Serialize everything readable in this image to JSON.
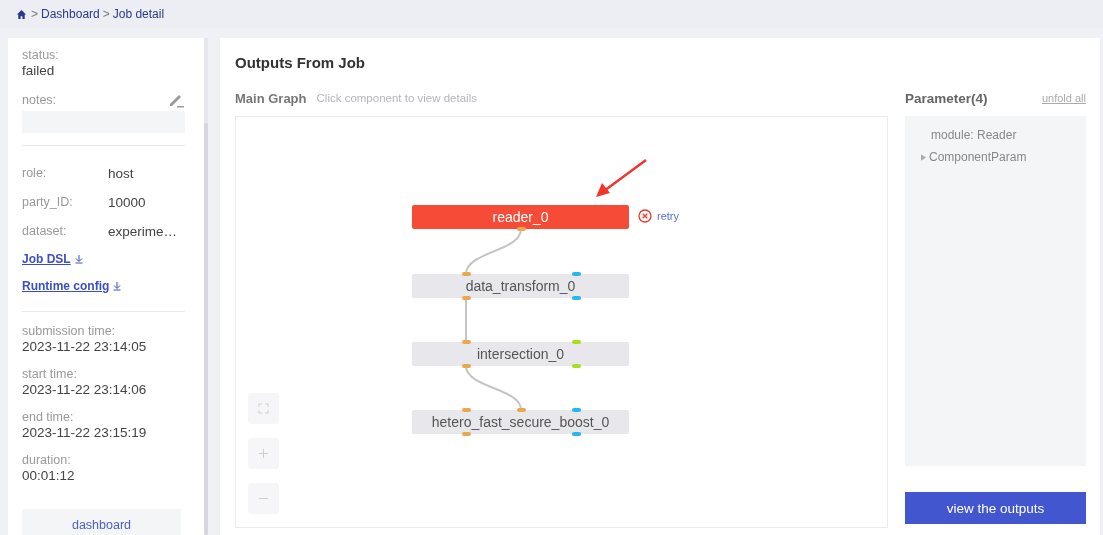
{
  "breadcrumb": [
    {
      "kind": "separator",
      "text": ">"
    },
    {
      "kind": "link",
      "text": "Dashboard"
    },
    {
      "kind": "separator",
      "text": ">"
    },
    {
      "kind": "link",
      "text": "Job detail"
    }
  ],
  "job": {
    "status_label": "status:",
    "status": "failed",
    "notes_label": "notes:"
  },
  "info": [
    {
      "label": "role:",
      "value": "host"
    },
    {
      "label": "party_ID:",
      "value": "10000"
    },
    {
      "label": "dataset:",
      "value": "experime…"
    }
  ],
  "downloads": [
    "Job DSL",
    "Runtime config"
  ],
  "times": [
    {
      "label": "submission time:",
      "value": "2023-11-22 23:14:05"
    },
    {
      "label": "start time:",
      "value": "2023-11-22 23:14:06"
    },
    {
      "label": "end time:",
      "value": "2023-11-22 23:15:19"
    },
    {
      "label": "duration:",
      "value": "00:01:12"
    }
  ],
  "dashboard_button": "dashboard",
  "title": "Outputs From Job",
  "graph": {
    "title": "Main Graph",
    "hint": "Click component to view details",
    "retry": "retry",
    "nodes": [
      {
        "name": "reader_0",
        "failed": true
      },
      {
        "name": "data_transform_0",
        "failed": false
      },
      {
        "name": "intersection_0",
        "failed": false
      },
      {
        "name": "hetero_fast_secure_boost_0",
        "failed": false
      }
    ]
  },
  "parameters": {
    "title": "Parameter(4)",
    "unfold": "unfold all",
    "items": [
      {
        "text": "module: Reader",
        "expandable": false
      },
      {
        "text": "ComponentParam",
        "expandable": true
      }
    ]
  },
  "outputs_button": "view the outputs"
}
